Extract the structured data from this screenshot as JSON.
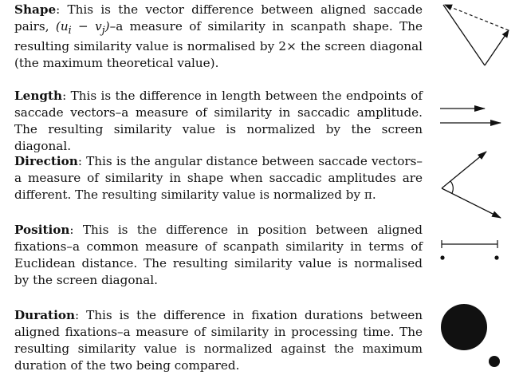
{
  "entries": [
    {
      "id": "shape",
      "term": "Shape",
      "lead": ": This is the vector difference between aligned saccade pairs, ",
      "math": "(u",
      "math_sub1": "i",
      "math_mid": " − v",
      "math_sub2": "j",
      "math_close": ")",
      "text": "–a measure of similarity in scanpath shape. The resulting similarity value is normalised by 2× the screen diagonal (the maximum theoretical value).",
      "icon": "vector-difference-icon"
    },
    {
      "id": "length",
      "term": "Length",
      "text": ": This is the difference in length between the endpoints of saccade vectors–a measure of similarity in saccadic amplitude. The resulting similarity value is normalized by the screen diagonal.",
      "icon": "parallel-arrows-icon"
    },
    {
      "id": "direction",
      "term": "Direction",
      "text": ": This is the angular distance between saccade vectors–a measure of similarity in shape when saccadic amplitudes are different. The resulting similarity value is normalized by π.",
      "icon": "angle-icon"
    },
    {
      "id": "position",
      "term": "Position",
      "text": ": This is the difference in position between aligned fixations–a common measure of scanpath similarity in terms of Euclidean distance. The resulting similarity value is normalised by the screen diagonal.",
      "icon": "distance-icon"
    },
    {
      "id": "duration",
      "term": "Duration",
      "text": ": This is the difference in fixation durations between aligned fixations–a measure of similarity in processing time. The resulting similarity value is normalized against the maximum duration of the two being compared.",
      "icon": "fixation-circles-icon"
    }
  ],
  "colors": {
    "ink": "#111111",
    "background": "#ffffff"
  }
}
